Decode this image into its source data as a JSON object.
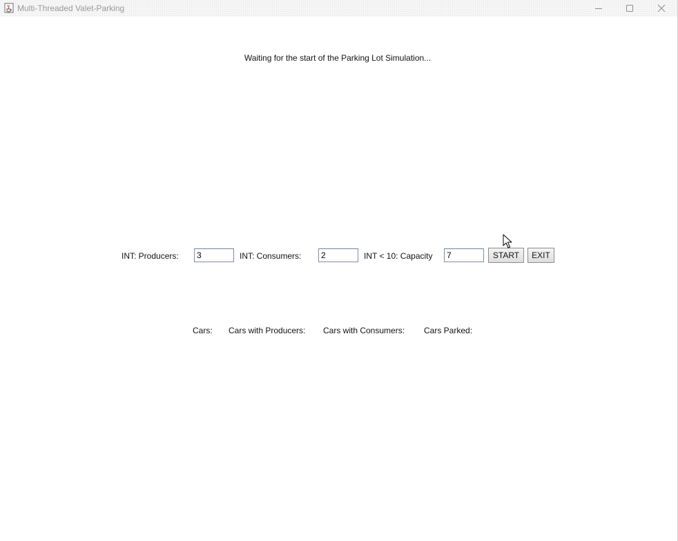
{
  "window": {
    "title": "Multi-Threaded Valet-Parking"
  },
  "status": {
    "message": "Waiting for the start of the Parking Lot Simulation..."
  },
  "controls": {
    "producers_label": "INT: Producers:",
    "producers_value": "3",
    "consumers_label": "INT: Consumers:",
    "consumers_value": "2",
    "capacity_label": "INT < 10: Capacity",
    "capacity_value": "7",
    "start_label": "START",
    "exit_label": "EXIT"
  },
  "stats": {
    "cars_label": "Cars:",
    "cars_with_producers_label": "Cars with Producers:",
    "cars_with_consumers_label": "Cars with Consumers:",
    "cars_parked_label": "Cars Parked:"
  },
  "icons": {
    "app": "java-cup-icon",
    "minimize": "minimize-icon",
    "maximize": "maximize-icon",
    "close": "close-icon",
    "cursor": "mouse-pointer-icon"
  }
}
